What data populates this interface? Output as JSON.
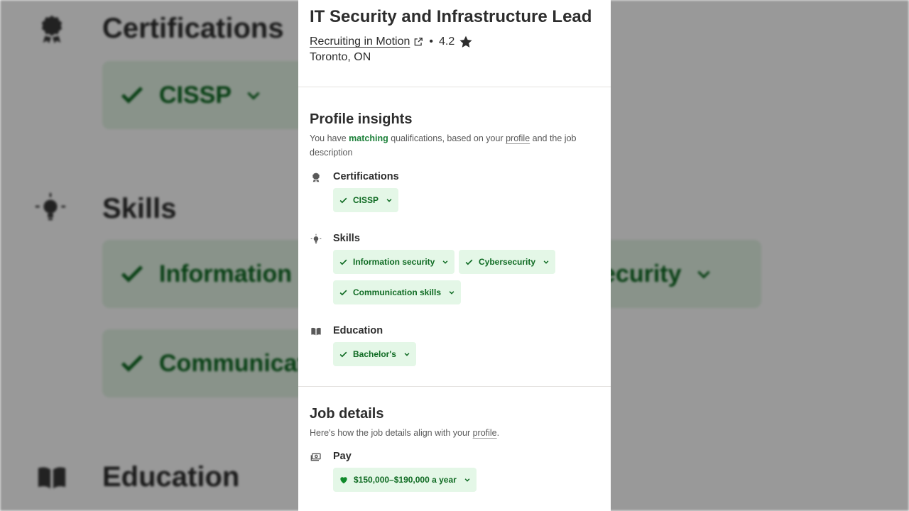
{
  "job": {
    "title": "IT Security and Infrastructure Lead",
    "company": "Recruiting in Motion",
    "rating": "4.2",
    "location": "Toronto, ON"
  },
  "insights": {
    "title": "Profile insights",
    "desc_prefix": "You have ",
    "desc_match": "matching",
    "desc_mid": " qualifications, based on your ",
    "desc_profile": "profile",
    "desc_suffix": " and the job description",
    "groups": {
      "certifications": {
        "label": "Certifications",
        "chips": [
          "CISSP"
        ]
      },
      "skills": {
        "label": "Skills",
        "chips": [
          "Information security",
          "Cybersecurity",
          "Communication skills"
        ]
      },
      "education": {
        "label": "Education",
        "chips": [
          "Bachelor's"
        ]
      }
    }
  },
  "job_details": {
    "title": "Job details",
    "desc_prefix": "Here's how the job details align with your ",
    "desc_profile": "profile",
    "desc_suffix": ".",
    "pay": {
      "label": "Pay",
      "value": "$150,000–$190,000 a year"
    }
  },
  "background": {
    "certifications_title": "Certifications",
    "skills_title": "Skills",
    "education_title": "Education",
    "chip_cissp": "CISSP",
    "chip_information": "Information",
    "chip_security": "ecurity",
    "chip_communication": "Communicat"
  },
  "colors": {
    "chip_bg": "#e4f7e7",
    "chip_text": "#0f6b23",
    "text": "#2d2d2d"
  }
}
